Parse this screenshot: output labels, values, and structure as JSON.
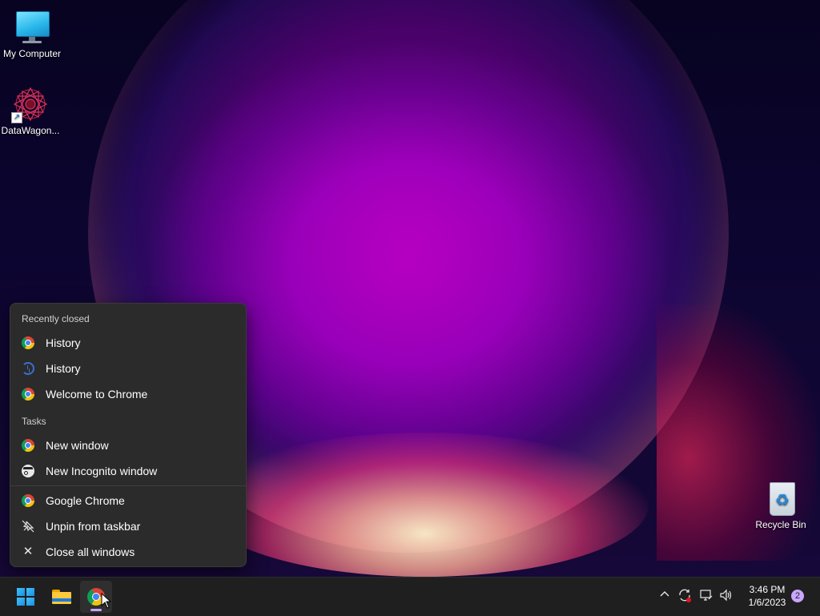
{
  "desktop": {
    "icons": [
      {
        "label": "My Computer",
        "icon": "monitor-icon"
      },
      {
        "label": "DataWagon...",
        "icon": "datawagon-app-icon"
      },
      {
        "label": "Recycle Bin",
        "icon": "recycle-bin-icon"
      }
    ]
  },
  "jumplist": {
    "recent_header": "Recently closed",
    "recent": [
      {
        "label": "History",
        "icon": "chrome-icon"
      },
      {
        "label": "History",
        "icon": "history-icon"
      },
      {
        "label": "Welcome to Chrome",
        "icon": "chrome-icon"
      }
    ],
    "tasks_header": "Tasks",
    "tasks": [
      {
        "label": "New window",
        "icon": "chrome-icon"
      },
      {
        "label": "New Incognito window",
        "icon": "incognito-icon"
      }
    ],
    "app_actions": [
      {
        "label": "Google Chrome",
        "icon": "chrome-icon"
      },
      {
        "label": "Unpin from taskbar",
        "icon": "unpin-icon"
      },
      {
        "label": "Close all windows",
        "icon": "close-icon"
      }
    ]
  },
  "taskbar": {
    "apps": [
      {
        "name": "Start",
        "icon": "windows-start-icon"
      },
      {
        "name": "File Explorer",
        "icon": "file-explorer-icon"
      },
      {
        "name": "Google Chrome",
        "icon": "chrome-icon",
        "active": true
      }
    ],
    "tray": {
      "time": "3:46 PM",
      "date": "1/6/2023",
      "notification_count": "2"
    }
  }
}
